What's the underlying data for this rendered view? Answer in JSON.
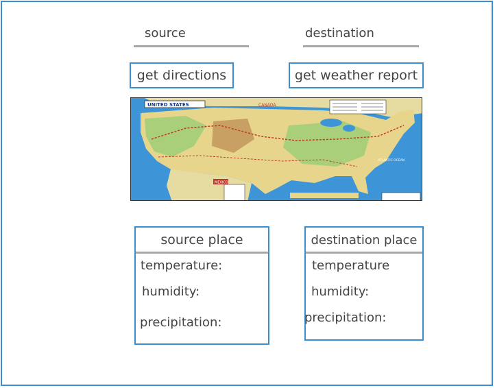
{
  "search": {
    "source_label": "source",
    "destination_label": "destination"
  },
  "buttons": {
    "get_directions": "get directions",
    "get_weather_report": "get weather report"
  },
  "map": {
    "country_label": "UNITED STATES",
    "canada_label": "CANADA",
    "mexico_label": "MEXICO",
    "ocean_label": "ATLANTIC OCEAN",
    "colors": {
      "water": "#3d95d7",
      "land": "#e8d58c",
      "land_green": "#a9cf7a"
    }
  },
  "source_panel": {
    "title": "source place",
    "temperature_label": "temperature:",
    "humidity_label": "humidity:",
    "precipitation_label": "precipitation:"
  },
  "destination_panel": {
    "title": "destination place",
    "temperature_label": "temperature",
    "humidity_label": "humidity:",
    "precipitation_label": "precipitation:"
  }
}
